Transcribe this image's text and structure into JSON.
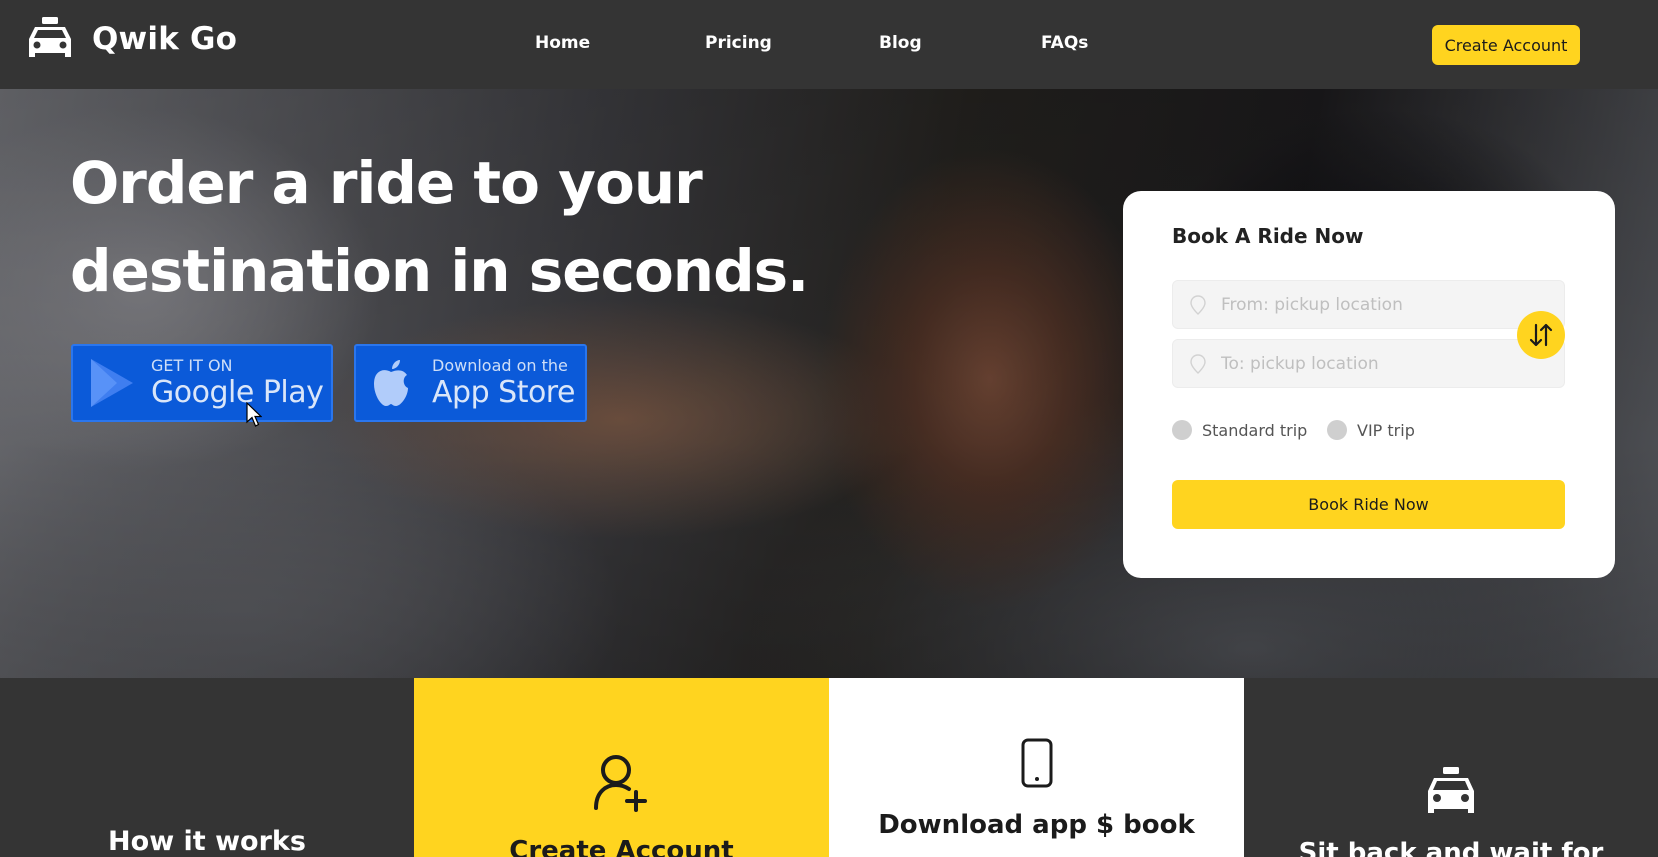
{
  "brand": {
    "name": "Qwik Go",
    "icon": "taxi-icon"
  },
  "nav": {
    "links": [
      "Home",
      "Pricing",
      "Blog",
      "FAQs"
    ],
    "cta": "Create Account"
  },
  "hero": {
    "title": "Order a ride to your destination in seconds.",
    "google_play": {
      "small": "GET IT ON",
      "big": "Google Play",
      "icon": "google-play-icon"
    },
    "app_store": {
      "small": "Download on the",
      "big": "App Store",
      "icon": "apple-icon"
    }
  },
  "booking": {
    "title": "Book A Ride Now",
    "from_placeholder": "From: pickup location",
    "to_placeholder": "To: pickup location",
    "swap_icon": "swap-arrows-icon",
    "trip_options": [
      "Standard trip",
      "VIP trip"
    ],
    "submit": "Book Ride Now"
  },
  "how_it_works": {
    "title": "How it works",
    "steps": [
      {
        "text": "Create Account",
        "icon": "add-user-icon"
      },
      {
        "text": "Download app $ book",
        "icon": "phone-icon"
      },
      {
        "text": "Sit back and wait for",
        "icon": "taxi-icon"
      }
    ]
  },
  "colors": {
    "accent": "#ffd41f",
    "nav_bg": "#343434",
    "store_blue": "#0b5ad9",
    "card_bg": "#ffffff"
  }
}
